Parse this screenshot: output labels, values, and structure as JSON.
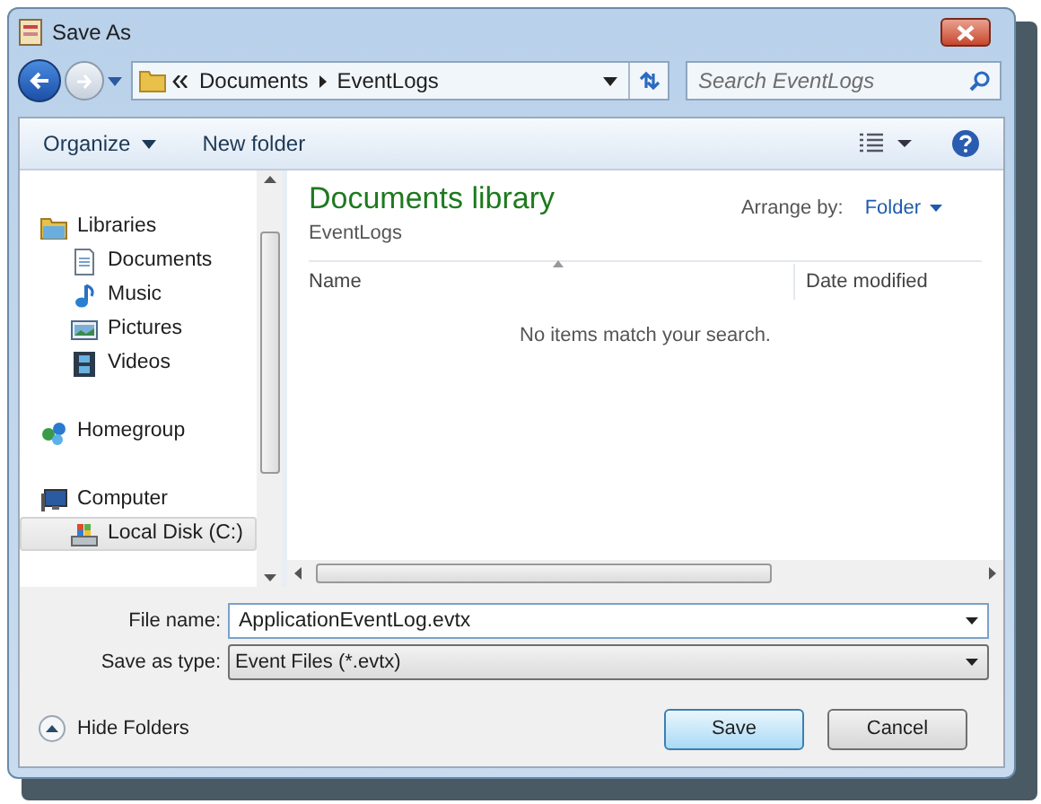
{
  "window": {
    "title": "Save As"
  },
  "address": {
    "crumbs": [
      "Documents",
      "EventLogs"
    ]
  },
  "search": {
    "placeholder": "Search EventLogs"
  },
  "toolbar": {
    "organize": "Organize",
    "new_folder": "New folder"
  },
  "nav": [
    {
      "label": "Libraries",
      "kind": "libraries",
      "selected": false,
      "children": [
        {
          "label": "Documents",
          "kind": "documents",
          "selected": false
        },
        {
          "label": "Music",
          "kind": "music",
          "selected": false
        },
        {
          "label": "Pictures",
          "kind": "pictures",
          "selected": false
        },
        {
          "label": "Videos",
          "kind": "videos",
          "selected": false
        }
      ]
    },
    {
      "label": "Homegroup",
      "kind": "homegroup",
      "selected": false
    },
    {
      "label": "Computer",
      "kind": "computer",
      "selected": false,
      "children": [
        {
          "label": "Local Disk (C:)",
          "kind": "disk",
          "selected": true
        }
      ]
    }
  ],
  "library": {
    "title": "Documents library",
    "subtitle": "EventLogs",
    "arrange_label": "Arrange by:",
    "arrange_value": "Folder"
  },
  "columns": [
    "Name",
    "Date modified"
  ],
  "empty_message": "No items match your search.",
  "file_name": {
    "label": "File name:",
    "value": "ApplicationEventLog.evtx"
  },
  "save_type": {
    "label": "Save as type:",
    "value": "Event Files (*.evtx)"
  },
  "hide_folders": "Hide Folders",
  "buttons": [
    {
      "label": "Save",
      "default": true
    },
    {
      "label": "Cancel",
      "default": false
    }
  ]
}
